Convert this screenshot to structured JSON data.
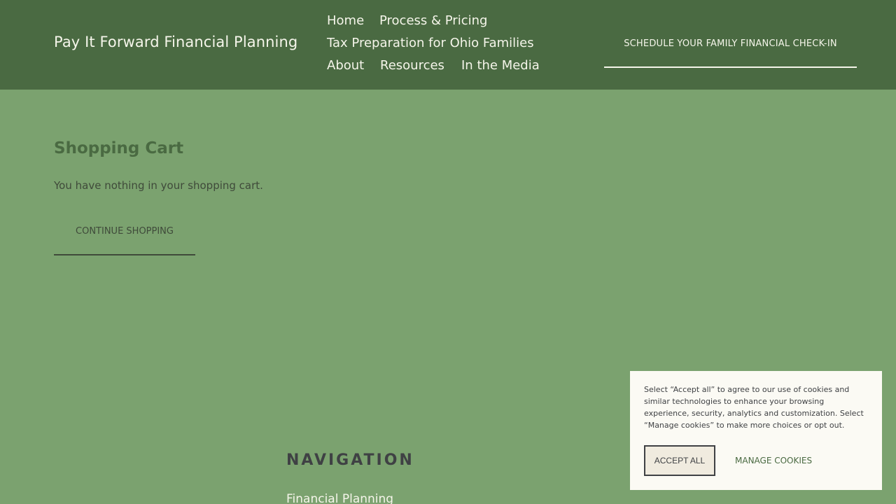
{
  "header": {
    "site_title": "Pay It Forward Financial Planning",
    "nav": [
      {
        "label": "Home"
      },
      {
        "label": "Process & Pricing"
      },
      {
        "label": "Tax Preparation for Ohio Families"
      },
      {
        "label": "About"
      },
      {
        "label": "Resources"
      },
      {
        "label": "In the Media"
      }
    ],
    "cta_label": "SCHEDULE YOUR FAMILY FINANCIAL CHECK-IN"
  },
  "main": {
    "title": "Shopping Cart",
    "empty_message": "You have nothing in your shopping cart.",
    "continue_label": "CONTINUE SHOPPING"
  },
  "footer": {
    "nav_heading": "NAVIGATION",
    "nav_first_link": "Financial Planning"
  },
  "cookie_banner": {
    "text": "Select “Accept all” to agree to our use of cookies and similar technologies to enhance your browsing experience, security, analytics and customization. Select “Manage cookies” to make more choices or opt out.",
    "accept_label": "ACCEPT ALL",
    "manage_label": "MANAGE COOKIES"
  },
  "colors": {
    "page_background": "#7ba26f",
    "header_background": "#4a6a42",
    "light_text": "#f5f5ea",
    "dark_text": "#3f4144",
    "banner_background": "#fbfaf4"
  }
}
